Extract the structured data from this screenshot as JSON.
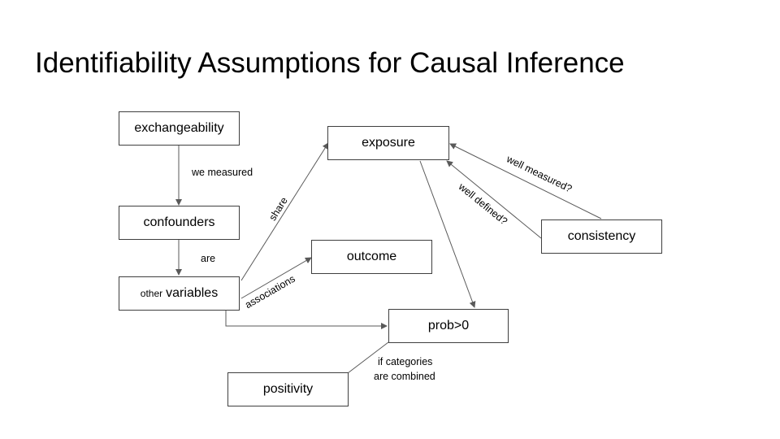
{
  "title": "Identifiability Assumptions for Causal Inference",
  "nodes": {
    "exchangeability": "exchangeability",
    "confounders": "confounders",
    "other_variables_small": "other",
    "other_variables_main": "variables",
    "exposure": "exposure",
    "outcome": "outcome",
    "consistency": "consistency",
    "prob": "prob>0",
    "positivity": "positivity"
  },
  "edge_labels": {
    "we_measured": "we measured",
    "are": "are",
    "share": "share",
    "associations": "associations",
    "well_measured": "well measured?",
    "well_defined": "well defined?",
    "if_categories_line1": "if categories",
    "if_categories_line2": "are combined"
  },
  "colors": {
    "line": "#595959",
    "border": "#3f3f3f"
  }
}
